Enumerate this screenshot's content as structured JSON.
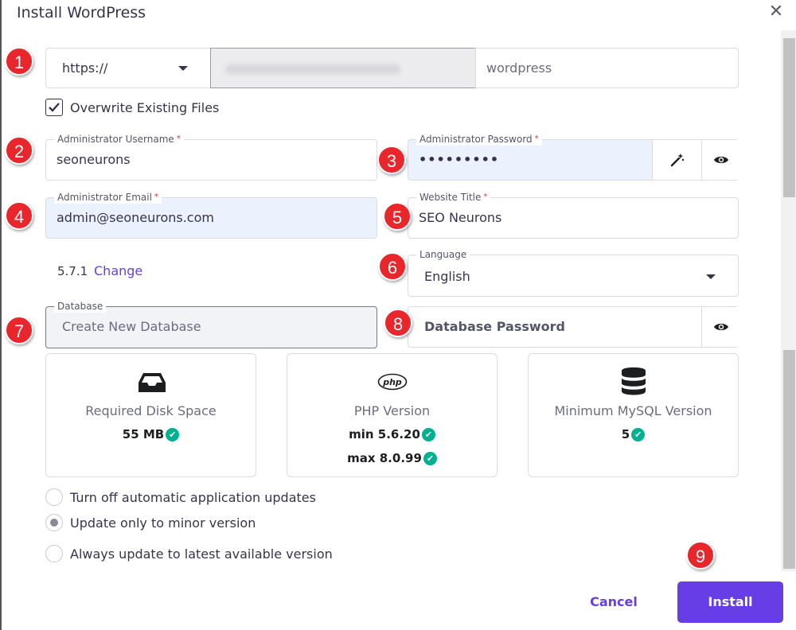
{
  "dialog": {
    "title": "Install WordPress"
  },
  "badges": [
    "1",
    "2",
    "3",
    "4",
    "5",
    "6",
    "7",
    "8",
    "9"
  ],
  "url": {
    "protocol": "https://",
    "domain": "",
    "path": "wordpress"
  },
  "overwrite": {
    "label": "Overwrite Existing Files",
    "checked": true
  },
  "admin_username": {
    "label": "Administrator Username",
    "value": "seoneurons"
  },
  "admin_password": {
    "label": "Administrator Password",
    "value": "•••••••••"
  },
  "admin_email": {
    "label": "Administrator Email",
    "value": "admin@seoneurons.com"
  },
  "website_title": {
    "label": "Website Title",
    "value": "SEO Neurons"
  },
  "version": {
    "number": "5.7.1",
    "change_label": "Change"
  },
  "language": {
    "label": "Language",
    "value": "English"
  },
  "database": {
    "label": "Database",
    "value": "Create New Database"
  },
  "db_password": {
    "placeholder": "Database Password"
  },
  "requirements": [
    {
      "title": "Required Disk Space",
      "values": [
        "55 MB"
      ],
      "icon": "inbox-tray-icon"
    },
    {
      "title": "PHP Version",
      "values": [
        "min 5.6.20",
        "max 8.0.99"
      ],
      "icon": "php-logo-icon"
    },
    {
      "title": "Minimum MySQL Version",
      "values": [
        "5"
      ],
      "icon": "database-icon"
    }
  ],
  "updates": {
    "options": [
      "Turn off automatic application updates",
      "Update only to minor version",
      "Always update to latest available version"
    ],
    "selected_index": 1
  },
  "actions": {
    "cancel": "Cancel",
    "install": "Install"
  },
  "colors": {
    "accent": "#673de6",
    "badge": "#e8262b",
    "check": "#00b090",
    "filled_field": "#ebf1fd"
  }
}
